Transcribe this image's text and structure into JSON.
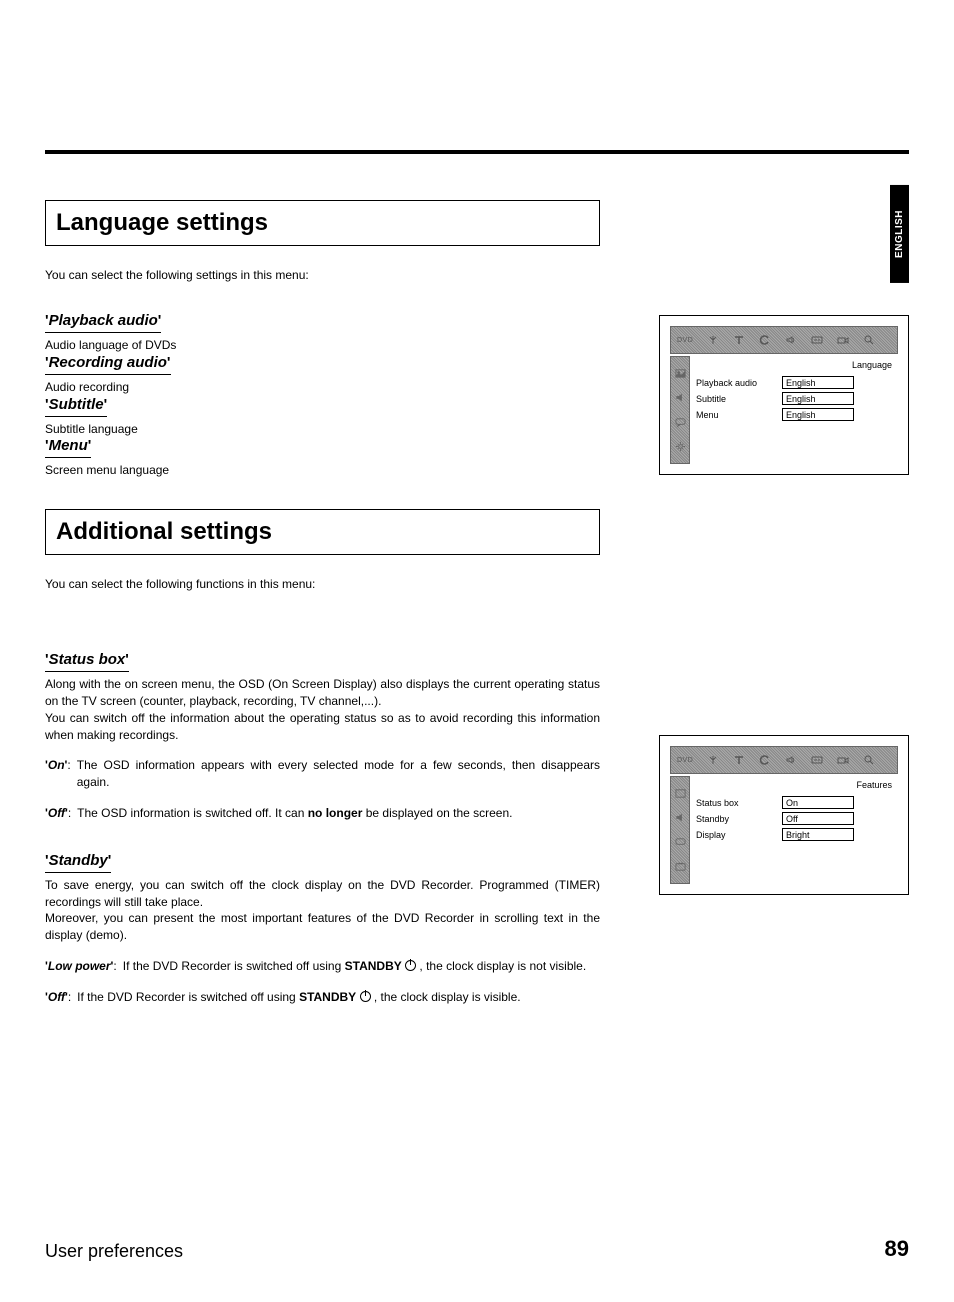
{
  "lang_tab": "ENGLISH",
  "sections": {
    "language": {
      "heading": "Language settings",
      "intro": "You can select the following settings in this menu:",
      "items": {
        "playback_audio": {
          "title": "Playback audio",
          "desc": "Audio language of DVDs"
        },
        "recording_audio": {
          "title": "Recording audio",
          "desc": "Audio recording"
        },
        "subtitle": {
          "title": "Subtitle",
          "desc": "Subtitle language"
        },
        "menu": {
          "title": "Menu",
          "desc": "Screen menu language"
        }
      }
    },
    "additional": {
      "heading": "Additional settings",
      "intro": "You can select the following functions in this menu:",
      "status_box": {
        "title": "Status box",
        "desc1": "Along with the on screen menu, the OSD (On Screen Display) also displays the current operating status on the TV screen (counter, playback, recording, TV channel,...).",
        "desc2": "You can switch off the information about the operating status so as to avoid recording this information when making recordings.",
        "opt_on_key": "On",
        "opt_on_val": "The OSD information appears with every selected mode for a few seconds, then disappears again.",
        "opt_off_key": "Off",
        "opt_off_val_pre": "The OSD information is switched off. It can ",
        "opt_off_bold": "no longer",
        "opt_off_val_post": " be displayed on the screen."
      },
      "standby": {
        "title": "Standby",
        "desc1": "To save energy, you can switch off the clock display on the DVD Recorder. Programmed (TIMER) recordings will still take place.",
        "desc2": "Moreover, you can present the most important features of the DVD Recorder in scrolling text in the display (demo).",
        "opt_low_key": "Low power",
        "opt_low_pre": "If the DVD Recorder is switched off using ",
        "opt_low_bold": "STANDBY",
        "opt_low_post": " , the clock display is not visible.",
        "opt_off_key": "Off",
        "opt_off_pre": "If the DVD Recorder is switched off using ",
        "opt_off_bold": "STANDBY",
        "opt_off_post": " , the clock display is visible."
      }
    }
  },
  "osd1": {
    "title": "Language",
    "rows": [
      {
        "label": "Playback audio",
        "value": "English"
      },
      {
        "label": "Subtitle",
        "value": "English"
      },
      {
        "label": "Menu",
        "value": "English"
      }
    ]
  },
  "osd2": {
    "title": "Features",
    "rows": [
      {
        "label": "Status box",
        "value": "On"
      },
      {
        "label": "Standby",
        "value": "Off"
      },
      {
        "label": "Display",
        "value": "Bright"
      }
    ]
  },
  "footer": {
    "left": "User preferences",
    "page": "89"
  }
}
